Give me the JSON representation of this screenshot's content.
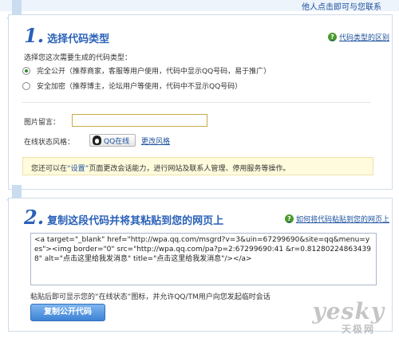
{
  "header": {
    "top_link": "他人点击即可与您联系"
  },
  "step1": {
    "number": "1.",
    "title": "选择代码类型",
    "help_link": "代码类型的区别",
    "prompt": "选择您这次需要生成的代码类型：",
    "options": [
      {
        "label": "完全公开（推荐商家，客服等用户使用，代码中显示QQ号码，易于推广）",
        "checked": true
      },
      {
        "label": "安全加密（推荐博主，论坛用户等使用，代码中不显示QQ号码）",
        "checked": false
      }
    ],
    "message_label": "图片留言：",
    "message_value": "",
    "style_label": "在线状态风格：",
    "qq_button_label": "QQ在线",
    "change_style_link": "更改风格",
    "tip_prefix": "您还可以在",
    "tip_highlight": "“设置”",
    "tip_suffix": "页面更改会话能力，进行网站及联系人管理、停用服务等操作。"
  },
  "step2": {
    "number": "2.",
    "title": "复制这段代码并将其粘贴到您的网页上",
    "help_link": "如何将代码粘贴到您的网页上",
    "code": "<a target=\"_blank\" href=\"http://wpa.qq.com/msgrd?v=3&uin=67299690&site=qq&menu=yes\"><img border=\"0\" src=\"http://wpa.qq.com/pa?p=2:67299690:41 &r=0.812802248634398\" alt=\"点击这里给我发消息\" title=\"点击这里给我发消息\"/></a>",
    "note": "粘贴后即可显示您的“在线状态”图标，并允许QQ/TM用户向您发起临时会话",
    "copy_button": "复制公开代码"
  },
  "watermark": {
    "main": "yesky",
    "sub": "天极网"
  }
}
